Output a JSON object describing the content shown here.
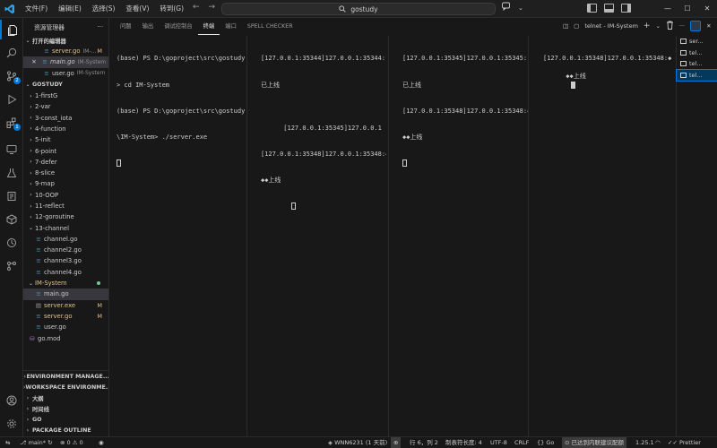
{
  "menu": [
    "文件(F)",
    "编辑(E)",
    "选择(S)",
    "查看(V)",
    "转到(G)"
  ],
  "search": {
    "text": "gostudy"
  },
  "window_controls": {
    "minimize": "—",
    "maximize": "☐",
    "close": "✕"
  },
  "sidebar": {
    "title": "资源管理器",
    "more": "···",
    "open_editors_label": "打开的编辑器",
    "open_editors": [
      {
        "name": "server.go",
        "folder": "IM-...",
        "mark": "M"
      },
      {
        "name": "main.go",
        "folder": "IM-System",
        "mark": ""
      },
      {
        "name": "user.go",
        "folder": "IM-System",
        "mark": ""
      }
    ],
    "workspace_label": "GOSTUDY",
    "folders": [
      "1-firstG",
      "2-var",
      "3-const_iota",
      "4-function",
      "5-init",
      "6-point",
      "7-defer",
      "8-slice",
      "9-map",
      "10-OOP",
      "11-reflect",
      "12-goroutine"
    ],
    "channel_folder": "13-channel",
    "channel_files": [
      "channel.go",
      "channel2.go",
      "channel3.go",
      "channel4.go"
    ],
    "im_folder": "IM-System",
    "im_files": [
      {
        "name": "main.go",
        "mark": ""
      },
      {
        "name": "server.exe",
        "mark": "M"
      },
      {
        "name": "server.go",
        "mark": "M"
      },
      {
        "name": "user.go",
        "mark": ""
      }
    ],
    "gomod": "go.mod",
    "bottom_sections": [
      "ENVIRONMENT MANAGE...",
      "WORKSPACE ENVIRONME...",
      "大纲",
      "时间线",
      "GO",
      "PACKAGE OUTLINE"
    ]
  },
  "panel": {
    "tabs": [
      "问题",
      "输出",
      "调试控制台",
      "终端",
      "端口",
      "SPELL CHECKER"
    ],
    "active_tab": "终端",
    "terminal_name": "telnet - IM-System",
    "add": "+",
    "more": "···",
    "close": "✕"
  },
  "terminals": [
    [
      "(base) PS D:\\goproject\\src\\gostudy",
      "> cd IM-System",
      "(base) PS D:\\goproject\\src\\gostudy",
      "\\IM-System> ./server.exe"
    ],
    [
      "[127.0.0.1:35344]127.0.0.1:35344:",
      "已上线",
      "",
      "      [127.0.0.1:35345]127.0.0.1",
      "[127.0.0.1:35348]127.0.0.1:35348:◆",
      "◆◆上线"
    ],
    [
      "[127.0.0.1:35345]127.0.0.1:35345:",
      "已上线",
      "[127.0.0.1:35348]127.0.0.1:35348:◆",
      "◆◆上线"
    ],
    [
      "[127.0.0.1:35348]127.0.0.1:35348:◆",
      "◆◆上线"
    ]
  ],
  "terminal_list": [
    "ser...",
    "tel...",
    "tel...",
    "tel..."
  ],
  "status": {
    "branch": "main*",
    "errors": "0",
    "warnings": "0",
    "remote": "WNN6231 (1 天前)",
    "position": "行 6，列 2",
    "tab_size": "制表符长度: 4",
    "encoding": "UTF-8",
    "eol": "CRLF",
    "language": "Go",
    "notice": "已达到内联建议配额",
    "go_version": "1.25.1",
    "formatter": "Prettier"
  },
  "colors": {
    "accent": "#0078d4",
    "modified": "#e2c08d",
    "go_blue": "#519aba"
  }
}
